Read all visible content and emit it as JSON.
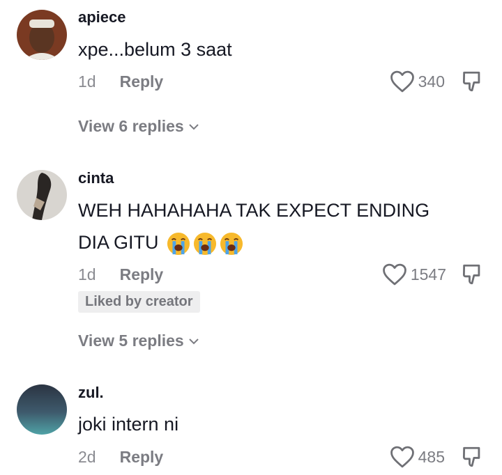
{
  "comments": [
    {
      "username": "apiece",
      "text": "xpe...belum 3 saat",
      "time": "1d",
      "reply_label": "Reply",
      "likes": "340",
      "view_replies": "View 6 replies"
    },
    {
      "username": "cinta",
      "text_line1": "WEH HAHAHAHA TAK EXPECT ENDING",
      "text_line2": "DIA GITU",
      "emoji": [
        "loudly-crying-face",
        "loudly-crying-face",
        "loudly-crying-face"
      ],
      "time": "1d",
      "reply_label": "Reply",
      "likes": "1547",
      "badge": "Liked by creator",
      "view_replies": "View 5 replies"
    },
    {
      "username": "zul.",
      "text": "joki intern ni",
      "time": "2d",
      "reply_label": "Reply",
      "likes": "485"
    }
  ],
  "icons": {
    "like": "heart-outline-icon",
    "dislike": "thumbs-down-outline-icon",
    "expand": "chevron-down-icon"
  },
  "colors": {
    "text": "#161823",
    "secondary": "#8a8b91",
    "badge_bg": "#eeeeef"
  }
}
